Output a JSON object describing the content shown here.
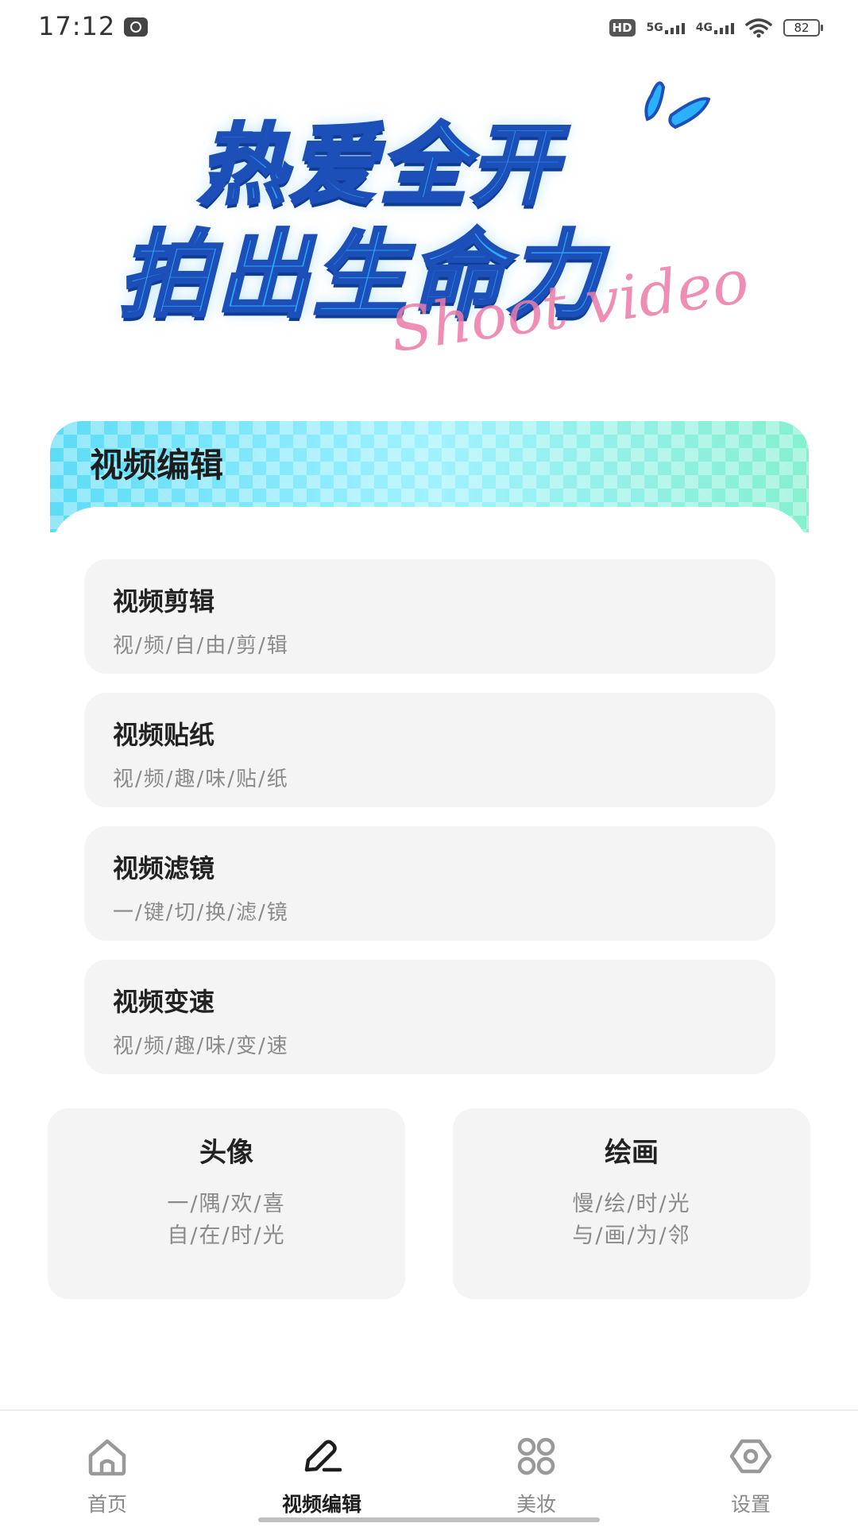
{
  "status_bar": {
    "time": "17:12",
    "hd_label": "HD",
    "network_5g": "5G",
    "network_4g": "4G",
    "battery": "82"
  },
  "banner": {
    "line1": "热爱全开",
    "line2": "拍出生命力",
    "script": "Shoot video"
  },
  "video_edit": {
    "title": "视频编辑",
    "items": [
      {
        "title": "视频剪辑",
        "subtitle": "视/频/自/由/剪/辑"
      },
      {
        "title": "视频贴纸",
        "subtitle": "视/频/趣/味/贴/纸"
      },
      {
        "title": "视频滤镜",
        "subtitle": "一/键/切/换/滤/镜"
      },
      {
        "title": "视频变速",
        "subtitle": "视/频/趣/味/变/速"
      }
    ]
  },
  "cards": [
    {
      "title": "头像",
      "line1": "一/隅/欢/喜",
      "line2": "自/在/时/光"
    },
    {
      "title": "绘画",
      "line1": "慢/绘/时/光",
      "line2": "与/画/为/邻"
    }
  ],
  "bottom_nav": {
    "items": [
      {
        "label": "首页",
        "icon": "home-icon",
        "active": false
      },
      {
        "label": "视频编辑",
        "icon": "edit-pen-icon",
        "active": true
      },
      {
        "label": "美妆",
        "icon": "grid-icon",
        "active": false
      },
      {
        "label": "设置",
        "icon": "settings-hexagon-icon",
        "active": false
      }
    ]
  },
  "colors": {
    "accent_active": "#1d1d1d",
    "inactive": "#888888",
    "banner_blue": "#29a9ff",
    "card_bg": "#f4f4f4"
  }
}
